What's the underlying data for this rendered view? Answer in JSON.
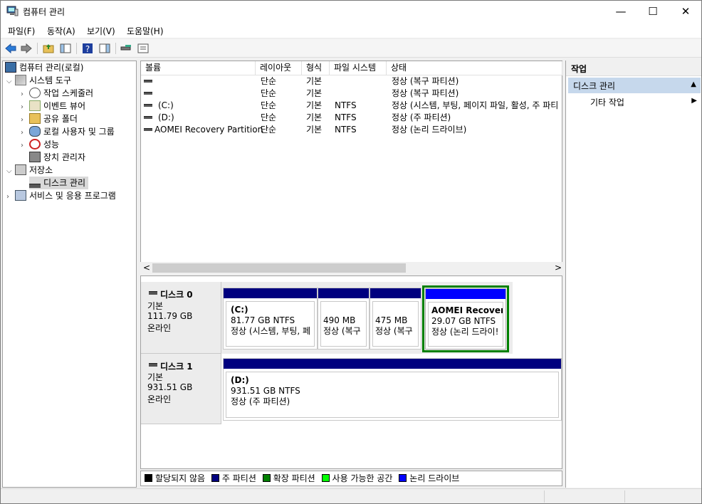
{
  "window": {
    "title": "컴퓨터 관리",
    "minimize": "—",
    "maximize": "☐",
    "close": "✕"
  },
  "menu": [
    "파일(F)",
    "동작(A)",
    "보기(V)",
    "도움말(H)"
  ],
  "tree": {
    "root": "컴퓨터 관리(로컬)",
    "system_tools": "시스템 도구",
    "task_scheduler": "작업 스케줄러",
    "event_viewer": "이벤트 뷰어",
    "shared_folders": "공유 폴더",
    "local_users": "로컬 사용자 및 그룹",
    "performance": "성능",
    "device_manager": "장치 관리자",
    "storage": "저장소",
    "disk_management": "디스크 관리",
    "services": "서비스 및 응용 프로그램"
  },
  "volume_columns": [
    "볼륨",
    "레이아웃",
    "형식",
    "파일 시스템",
    "상태"
  ],
  "volumes": [
    {
      "name": "",
      "layout": "단순",
      "type": "기본",
      "fs": "",
      "status": "정상 (복구 파티션)"
    },
    {
      "name": "",
      "layout": "단순",
      "type": "기본",
      "fs": "",
      "status": "정상 (복구 파티션)"
    },
    {
      "name": "(C:)",
      "layout": "단순",
      "type": "기본",
      "fs": "NTFS",
      "status": "정상 (시스템, 부팅, 페이지 파일, 활성, 주 파티"
    },
    {
      "name": "(D:)",
      "layout": "단순",
      "type": "기본",
      "fs": "NTFS",
      "status": "정상 (주 파티션)"
    },
    {
      "name": "AOMEI Recovery Partition",
      "layout": "단순",
      "type": "기본",
      "fs": "NTFS",
      "status": "정상 (논리 드라이브)"
    }
  ],
  "scroll": {
    "left": "<",
    "right": ">"
  },
  "disks": [
    {
      "name": "디스크 0",
      "type": "기본",
      "size": "111.79 GB",
      "state": "온라인",
      "partitions": [
        {
          "title": "(C:)",
          "size": "81.77 GB NTFS",
          "status": "정상 (시스템, 부팅, 페"
        },
        {
          "title": "",
          "size": "490 MB",
          "status": "정상 (복구"
        },
        {
          "title": "",
          "size": "475 MB",
          "status": "정상 (복구"
        },
        {
          "title": "AOMEI Recovery",
          "size": "29.07 GB NTFS",
          "status": "정상 (논리 드라이!"
        }
      ]
    },
    {
      "name": "디스크 1",
      "type": "기본",
      "size": "931.51 GB",
      "state": "온라인",
      "partitions": [
        {
          "title": "(D:)",
          "size": "931.51 GB NTFS",
          "status": "정상 (주 파티션)"
        }
      ]
    }
  ],
  "legend": [
    {
      "label": "할당되지 않음",
      "color": "#000000"
    },
    {
      "label": "주 파티션",
      "color": "#00007f"
    },
    {
      "label": "확장 파티션",
      "color": "#008000"
    },
    {
      "label": "사용 가능한 공간",
      "color": "#00ff00"
    },
    {
      "label": "논리 드라이브",
      "color": "#0000ff"
    }
  ],
  "actions": {
    "header": "작업",
    "section": "디스크 관리",
    "section_arrow": "▲",
    "more": "기타 작업",
    "more_arrow": "▶"
  },
  "colors": {
    "primary_partition": "#00007f",
    "logical_drive": "#0000ff",
    "extended_partition": "#008000",
    "selection": "#d9d9d9"
  }
}
